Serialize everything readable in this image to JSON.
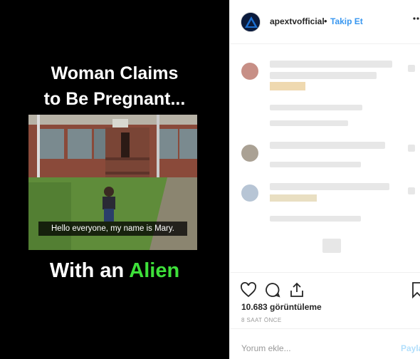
{
  "media": {
    "headline_line1": "Woman Claims",
    "headline_line2": "to Be Pregnant...",
    "subtitle": "Hello everyone, my name is Mary.",
    "bottom_prefix": "With an ",
    "bottom_accent": "Alien",
    "accent_color": "#3ee03a"
  },
  "post_header": {
    "username": "apextvofficial",
    "separator": "•",
    "follow_label": "Takip Et",
    "more_icon": "ellipsis-icon"
  },
  "actions": {
    "like_icon": "heart-icon",
    "comment_icon": "comment-bubble-icon",
    "share_icon": "share-icon",
    "save_icon": "bookmark-icon",
    "views": "10.683 görüntüleme",
    "time": "8 SAAT ÖNCE"
  },
  "comment_box": {
    "placeholder": "Yorum ekle...",
    "post_label": "Payla"
  },
  "colors": {
    "link": "#3897f0",
    "post_disabled": "#b2dffc"
  }
}
